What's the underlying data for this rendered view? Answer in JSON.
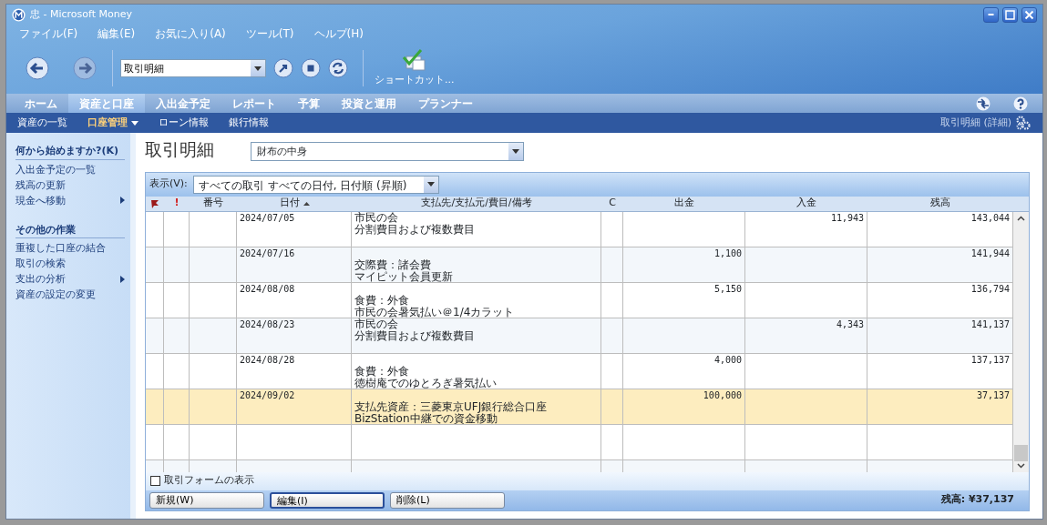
{
  "window": {
    "title": "忠 - Microsoft Money"
  },
  "menu": [
    "ファイル(F)",
    "編集(E)",
    "お気に入り(A)",
    "ツール(T)",
    "ヘルプ(H)"
  ],
  "toolbar": {
    "address": "取引明細",
    "shortcut_label": "ショートカット..."
  },
  "tabs": [
    {
      "label": "ホーム",
      "selected": false
    },
    {
      "label": "資産と口座",
      "selected": true
    },
    {
      "label": "入出金予定",
      "selected": false
    },
    {
      "label": "レポート",
      "selected": false
    },
    {
      "label": "予算",
      "selected": false
    },
    {
      "label": "投資と運用",
      "selected": false
    },
    {
      "label": "プランナー",
      "selected": false
    }
  ],
  "subnav": {
    "items": [
      {
        "label": "資産の一覧",
        "selected": false,
        "has_dropdown": false
      },
      {
        "label": "口座管理",
        "selected": true,
        "has_dropdown": true
      },
      {
        "label": "ローン情報",
        "selected": false,
        "has_dropdown": false
      },
      {
        "label": "銀行情報",
        "selected": false,
        "has_dropdown": false
      }
    ],
    "page_label": "取引明細 (詳細)"
  },
  "sidebar": {
    "sections": [
      {
        "heading": "何から始めますか?(K)",
        "items": [
          {
            "label": "入出金予定の一覧",
            "has_submenu": false
          },
          {
            "label": "残高の更新",
            "has_submenu": false
          },
          {
            "label": "現金へ移動",
            "has_submenu": true
          }
        ]
      },
      {
        "heading": "その他の作業",
        "items": [
          {
            "label": "重複した口座の結合",
            "has_submenu": false
          },
          {
            "label": "取引の検索",
            "has_submenu": false
          },
          {
            "label": "支出の分析",
            "has_submenu": true
          },
          {
            "label": "資産の設定の変更",
            "has_submenu": false
          }
        ]
      }
    ]
  },
  "page": {
    "title": "取引明細",
    "account": "財布の中身"
  },
  "register": {
    "view_label": "表示(V):",
    "view": "すべての取引 すべての日付, 日付順 (昇順)",
    "columns": [
      {
        "kind": "flag",
        "sorted": false
      },
      {
        "kind": "text",
        "label": "!",
        "sorted": false
      },
      {
        "kind": "text",
        "label": "番号",
        "sorted": false
      },
      {
        "kind": "text",
        "label": "日付",
        "sorted": true
      },
      {
        "kind": "text",
        "label": "支払先/支払元/費目/備考",
        "sorted": false
      },
      {
        "kind": "text",
        "label": "C",
        "sorted": false
      },
      {
        "kind": "text",
        "label": "出金",
        "sorted": false
      },
      {
        "kind": "text",
        "label": "入金",
        "sorted": false
      },
      {
        "kind": "text",
        "label": "残高",
        "sorted": false
      }
    ],
    "rows": [
      {
        "date": "2024/07/05",
        "payee": "市民の会",
        "category": "分割費目および複数費目",
        "deposit": "11,943",
        "balance": "143,044",
        "selected": false
      },
      {
        "date": "2024/07/16",
        "category": "交際費：諸会費",
        "memo": "マイピット会員更新",
        "withdrawal": "1,100",
        "balance": "141,944",
        "selected": false
      },
      {
        "date": "2024/08/08",
        "category": "食費：外食",
        "memo": "市民の会暑気払い＠1/4カラット",
        "withdrawal": "5,150",
        "balance": "136,794",
        "selected": false
      },
      {
        "date": "2024/08/23",
        "payee": "市民の会",
        "category": "分割費目および複数費目",
        "deposit": "4,343",
        "balance": "141,137",
        "selected": false
      },
      {
        "date": "2024/08/28",
        "category": "食費：外食",
        "memo": "徳樹庵でのゆとろぎ暑気払い",
        "withdrawal": "4,000",
        "balance": "137,137",
        "selected": false
      },
      {
        "date": "2024/09/02",
        "category": "支払先資産：三菱東京UFJ銀行総合口座",
        "memo": "BizStation中継での資金移動",
        "withdrawal": "100,000",
        "balance": "37,137",
        "selected": true
      }
    ],
    "show_form": {
      "label": "取引フォームの表示",
      "checked": false
    },
    "buttons": [
      {
        "label": "新規(W)",
        "focused": false
      },
      {
        "label": "編集(I)",
        "focused": true
      },
      {
        "label": "削除(L)",
        "focused": false
      }
    ],
    "total": "残高: ¥37,137"
  }
}
